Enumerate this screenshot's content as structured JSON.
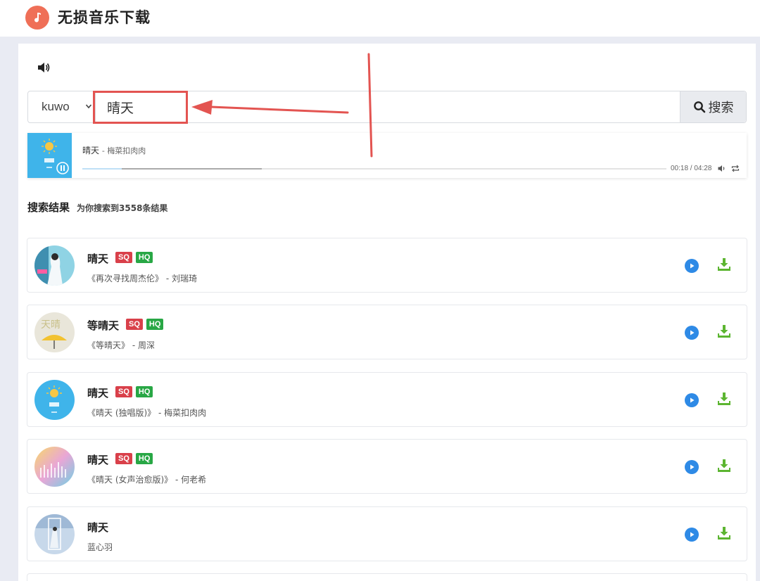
{
  "app": {
    "title": "无损音乐下载"
  },
  "search": {
    "source": "kuwo",
    "query": "晴天",
    "button_label": "搜索"
  },
  "player": {
    "title": "晴天",
    "artist": "梅菜扣肉肉",
    "time": "00:18 / 04:28",
    "progress": 0.067
  },
  "results": {
    "heading": "搜索结果",
    "count_text": "为你搜索到3558条结果",
    "items": [
      {
        "title": "晴天",
        "subtitle": "《再次寻找周杰伦》 - 刘瑞琦",
        "sq": "SQ",
        "hq": "HQ"
      },
      {
        "title": "等晴天",
        "subtitle": "《等晴天》 - 周深",
        "sq": "SQ",
        "hq": "HQ"
      },
      {
        "title": "晴天",
        "subtitle": "《晴天 (独唱版)》 - 梅菜扣肉肉",
        "sq": "SQ",
        "hq": "HQ"
      },
      {
        "title": "晴天",
        "subtitle": "《晴天 (女声治愈版)》 - 何老希",
        "sq": "SQ",
        "hq": "HQ"
      },
      {
        "title": "晴天",
        "subtitle": "蓝心羽"
      }
    ]
  },
  "colors": {
    "accent": "#2e8ae6",
    "download": "#5cb531",
    "sq": "#d9404a",
    "hq": "#28a745",
    "annotation": "#e35451"
  }
}
